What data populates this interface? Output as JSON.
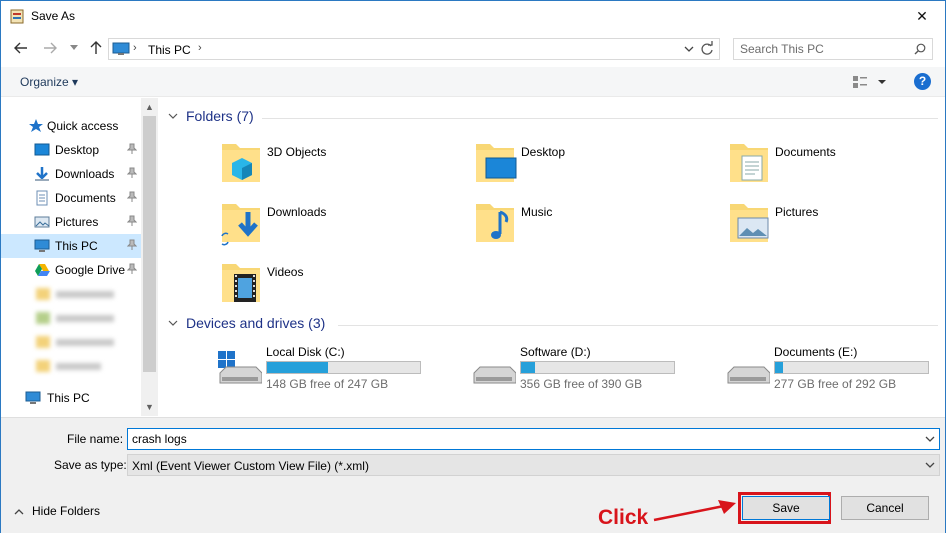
{
  "window": {
    "title": "Save As",
    "close_glyph": "✕"
  },
  "nav": {
    "back_icon": "back-arrow-icon",
    "forward_icon": "forward-arrow-icon",
    "recent_icon": "chevron-down-icon",
    "up_icon": "up-arrow-icon"
  },
  "address": {
    "crumb": "This PC",
    "sep": "›"
  },
  "search": {
    "placeholder": "Search This PC"
  },
  "toolbar": {
    "organize_label": "Organize ▾",
    "help_label": "?"
  },
  "sidebar": {
    "items": [
      {
        "label": "Quick access"
      },
      {
        "label": "Desktop"
      },
      {
        "label": "Downloads"
      },
      {
        "label": "Documents"
      },
      {
        "label": "Pictures"
      },
      {
        "label": "This PC"
      },
      {
        "label": "Google Drive"
      },
      {
        "label": "This PC"
      }
    ]
  },
  "folders": {
    "heading": "Folders (7)",
    "items": [
      {
        "label": "3D Objects"
      },
      {
        "label": "Desktop"
      },
      {
        "label": "Documents"
      },
      {
        "label": "Downloads"
      },
      {
        "label": "Music"
      },
      {
        "label": "Pictures"
      },
      {
        "label": "Videos"
      }
    ]
  },
  "devices": {
    "heading": "Devices and drives (3)",
    "items": [
      {
        "name": "Local Disk (C:)",
        "free": "148 GB free of 247 GB",
        "used_fraction": 0.4
      },
      {
        "name": "Software (D:)",
        "free": "356 GB free of 390 GB",
        "used_fraction": 0.09
      },
      {
        "name": "Documents (E:)",
        "free": "277 GB free of 292 GB",
        "used_fraction": 0.05
      }
    ]
  },
  "bottom": {
    "file_name_label": "File name:",
    "file_name_value": "crash logs",
    "save_type_label": "Save as type:",
    "save_type_value": "Xml (Event Viewer Custom View File) (*.xml)",
    "hide_folders_label": "Hide Folders",
    "save_label": "Save",
    "cancel_label": "Cancel"
  },
  "annotation": {
    "click_text": "Click",
    "color": "#d8141b"
  }
}
